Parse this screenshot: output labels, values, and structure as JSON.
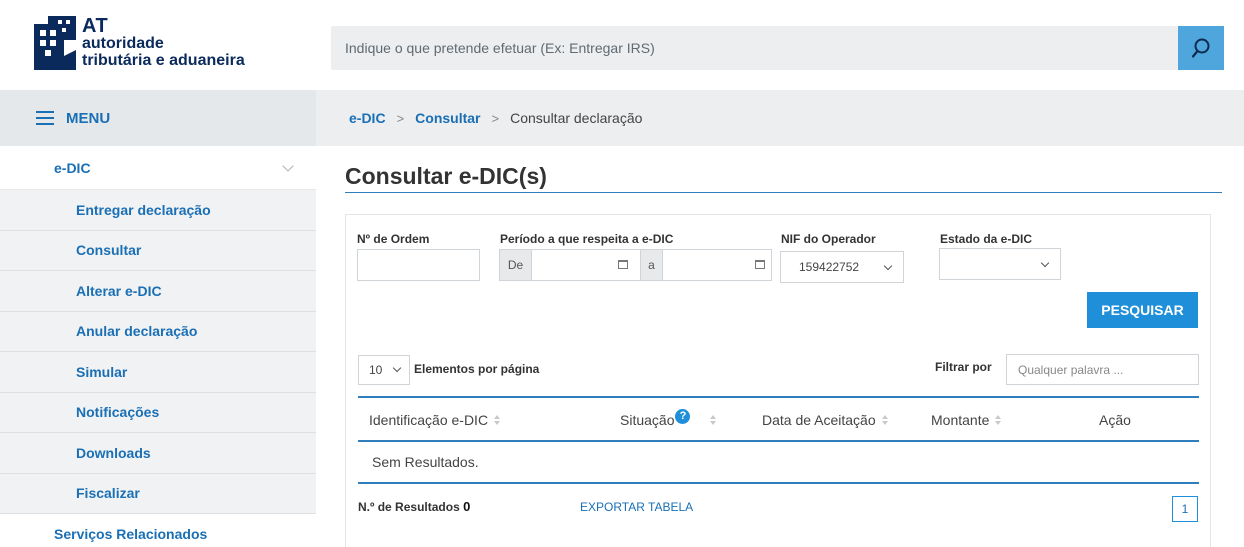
{
  "header": {
    "logo": {
      "abbr": "AT",
      "line1": "autoridade",
      "line2": "tributária e aduaneira"
    },
    "search_placeholder": "Indique o que pretende efetuar (Ex: Entregar IRS)",
    "search_icon": "search-icon"
  },
  "sidebar": {
    "menu_label": "MENU",
    "group_label": "e-DIC",
    "items": [
      {
        "label": "Entregar declaração"
      },
      {
        "label": "Consultar"
      },
      {
        "label": "Alterar e-DIC"
      },
      {
        "label": "Anular declaração"
      },
      {
        "label": "Simular"
      },
      {
        "label": "Notificações"
      },
      {
        "label": "Downloads"
      },
      {
        "label": "Fiscalizar"
      }
    ],
    "related_label": "Serviços Relacionados"
  },
  "breadcrumb": {
    "items": [
      "e-DIC",
      "Consultar",
      "Consultar declaração"
    ],
    "separator": ">"
  },
  "page": {
    "title": "Consultar e-DIC(s)"
  },
  "form": {
    "ordem_label": "Nº de Ordem",
    "ordem_value": "",
    "periodo_label": "Período a que respeita a e-DIC",
    "periodo_from_addon": "De",
    "periodo_to_addon": "a",
    "nif_label": "NIF do Operador",
    "nif_value": "159422752",
    "estado_label": "Estado da e-DIC",
    "estado_value": "",
    "search_button": "PESQUISAR"
  },
  "table": {
    "page_size": "10",
    "page_size_label": "Elementos por página",
    "filter_label": "Filtrar por",
    "filter_placeholder": "Qualquer palavra ...",
    "columns": [
      {
        "label": "Identificação e-DIC",
        "sortable": true
      },
      {
        "label": "Situação",
        "sortable": true,
        "help": "?"
      },
      {
        "label": "Data de Aceitação",
        "sortable": true
      },
      {
        "label": "Montante",
        "sortable": true
      },
      {
        "label": "Ação",
        "sortable": false
      }
    ],
    "empty_text": "Sem Resultados.",
    "results_label": "N.º de Resultados",
    "results_count": "0",
    "export_label": "EXPORTAR TABELA",
    "current_page": "1"
  },
  "colors": {
    "brand_blue": "#1a6fb5",
    "accent_blue": "#1e8fd8",
    "search_button": "#4ea6dc",
    "sidebar_sub_bg": "#f0f2f3",
    "bar_bg": "#eceeef"
  }
}
